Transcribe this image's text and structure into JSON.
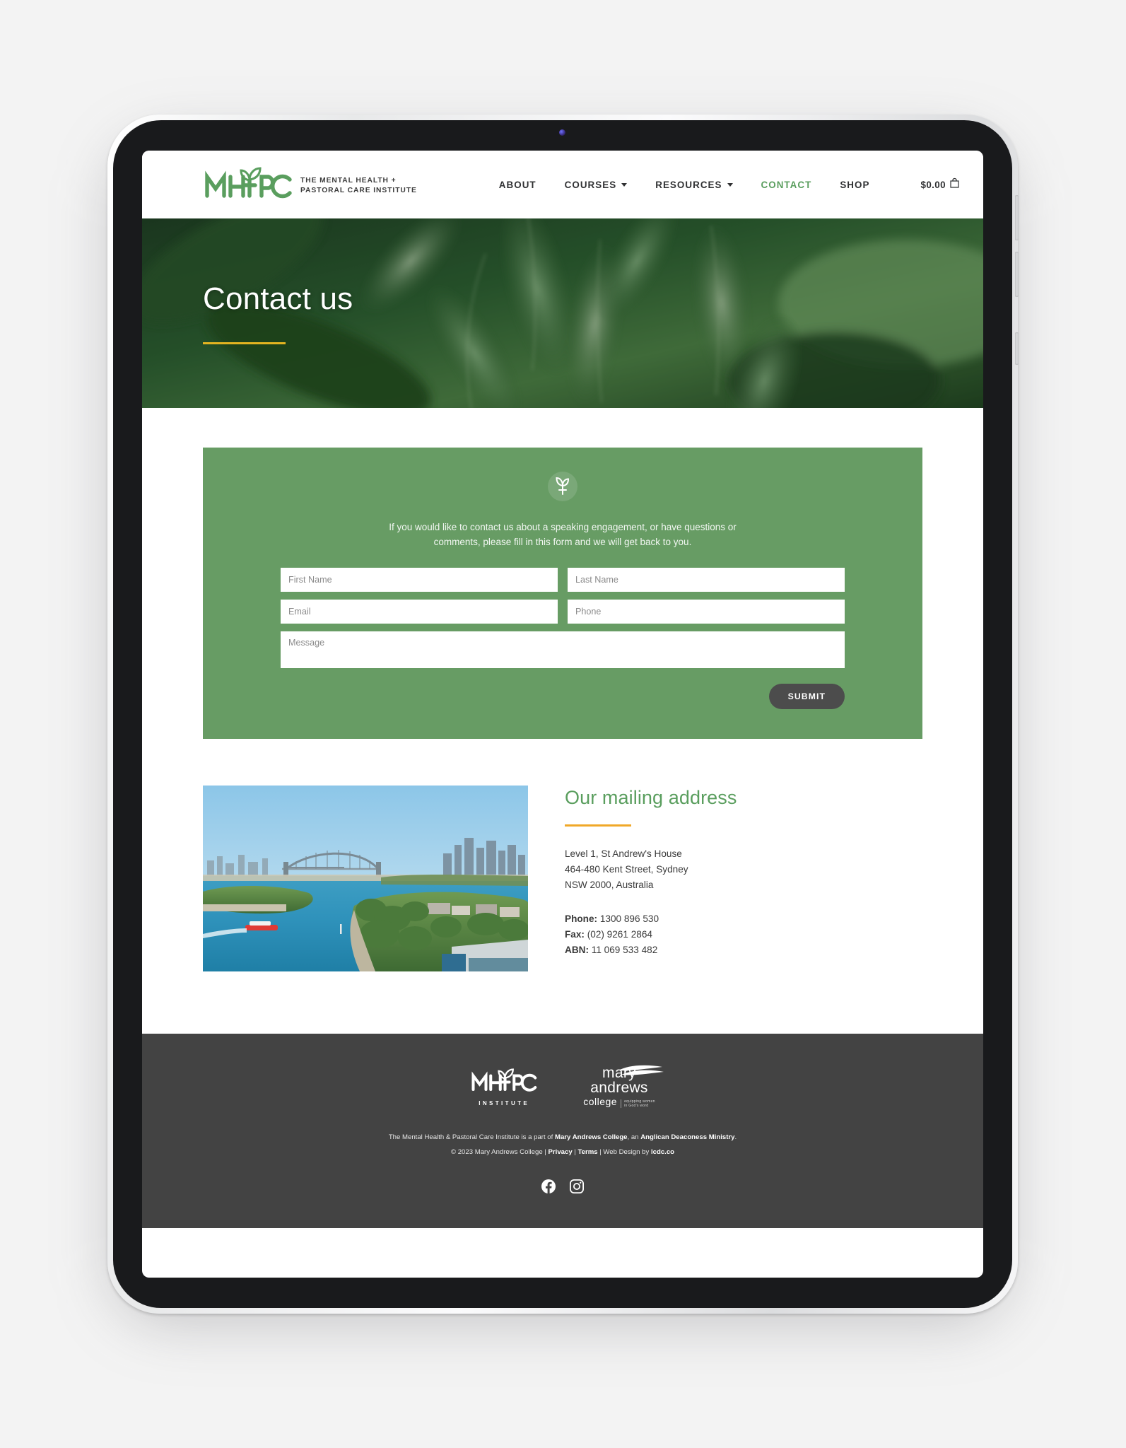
{
  "brand": {
    "mark_text": "MHPC",
    "tagline_line1": "THE MENTAL HEALTH +",
    "tagline_line2": "PASTORAL CARE INSTITUTE",
    "leaf_icon": "leaf-icon",
    "accent_green": "#5a9e5e",
    "panel_green": "#679c64",
    "accent_yellow": "#e3b421",
    "accent_orange": "#f0a828",
    "footer_grey": "#434343"
  },
  "nav": {
    "items": [
      {
        "label": "ABOUT",
        "has_dropdown": false,
        "active": false
      },
      {
        "label": "COURSES",
        "has_dropdown": true,
        "active": false
      },
      {
        "label": "RESOURCES",
        "has_dropdown": true,
        "active": false
      },
      {
        "label": "CONTACT",
        "has_dropdown": false,
        "active": true
      },
      {
        "label": "SHOP",
        "has_dropdown": false,
        "active": false
      }
    ],
    "cart_amount": "$0.00",
    "cart_icon": "shopping-bag-icon"
  },
  "hero": {
    "title": "Contact us",
    "image_alt": "green-leaves-photo"
  },
  "form": {
    "icon": "sprout-icon",
    "intro": "If you would like to contact us about a speaking engagement, or have questions or comments, please fill in this form and we will get back to you.",
    "fields": {
      "first_name": {
        "placeholder": "First Name",
        "value": ""
      },
      "last_name": {
        "placeholder": "Last Name",
        "value": ""
      },
      "email": {
        "placeholder": "Email",
        "value": ""
      },
      "phone": {
        "placeholder": "Phone",
        "value": ""
      },
      "message": {
        "placeholder": "Message",
        "value": ""
      }
    },
    "submit_label": "SUBMIT"
  },
  "address": {
    "image_alt": "sydney-harbour-photo",
    "title": "Our mailing address",
    "lines": [
      "Level 1, St Andrew's House",
      "464-480 Kent Street, Sydney",
      "NSW 2000, Australia"
    ],
    "phone_label": "Phone:",
    "phone_value": "1300 896 530",
    "fax_label": "Fax:",
    "fax_value": "(02) 9261 2864",
    "abn_label": "ABN:",
    "abn_value": "11 069 533 482"
  },
  "footer": {
    "mhpc_mark": "MHPC",
    "mhpc_sub": "INSTITUTE",
    "mac_line1": "mary",
    "mac_line2": "andrews",
    "mac_line3": "college",
    "mac_sub1": "equipping women",
    "mac_sub2": "in God's word",
    "statement_prefix": "The Mental Health & Pastoral Care Institute is a part of ",
    "statement_bold1": "Mary Andrews College",
    "statement_mid": ", an ",
    "statement_bold2": "Anglican Deaconess Ministry",
    "statement_suffix": ".",
    "copyright": "© 2023 Mary Andrews College | ",
    "privacy": "Privacy",
    "sep1": " | ",
    "terms": "Terms",
    "sep2": " | Web Design by ",
    "designer": "lcdc.co",
    "social": [
      {
        "name": "facebook-icon",
        "label": "Facebook"
      },
      {
        "name": "instagram-icon",
        "label": "Instagram"
      }
    ]
  }
}
